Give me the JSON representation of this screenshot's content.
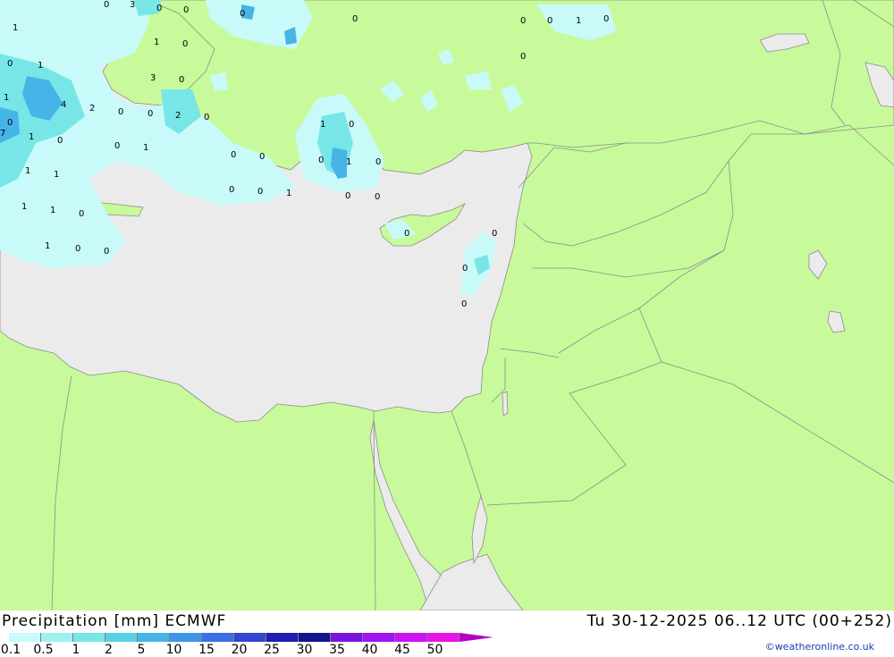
{
  "header": {
    "title": "Precipitation [mm] ECMWF",
    "valid_time": "Tu 30-12-2025 06..12 UTC (00+252)"
  },
  "legend": {
    "ticks": [
      "0.1",
      "0.5",
      "1",
      "2",
      "5",
      "10",
      "15",
      "20",
      "25",
      "30",
      "35",
      "40",
      "45",
      "50"
    ],
    "colors": [
      "#c8fafa",
      "#a0f0f0",
      "#78e6e6",
      "#5ad2e6",
      "#46b4e6",
      "#3c96e6",
      "#3c6ee6",
      "#3246d2",
      "#1e1eb4",
      "#14148c",
      "#7814dc",
      "#a014f0",
      "#c814f0",
      "#e614e6",
      "#b400c8"
    ]
  },
  "credit": "©weatheronline.co.uk",
  "colors": {
    "land": "#c8fa9b",
    "sea": "#ebebeb",
    "border": "#8c8c8c"
  },
  "map": {
    "values": [
      "0",
      "3",
      "0",
      "0",
      "0",
      "1",
      "0",
      "0",
      "1",
      "0",
      "0",
      "0",
      "1",
      "0",
      "0",
      "3",
      "0",
      "1",
      "1",
      "4",
      "2",
      "0",
      "0",
      "2",
      "0",
      "7",
      "1",
      "0",
      "0",
      "1",
      "0",
      "0",
      "1",
      "1",
      "1",
      "0",
      "0",
      "1",
      "0",
      "0",
      "0",
      "1",
      "0",
      "0",
      "0",
      "1",
      "1",
      "0",
      "1",
      "0",
      "0",
      "0",
      "0",
      "0",
      "0"
    ]
  }
}
